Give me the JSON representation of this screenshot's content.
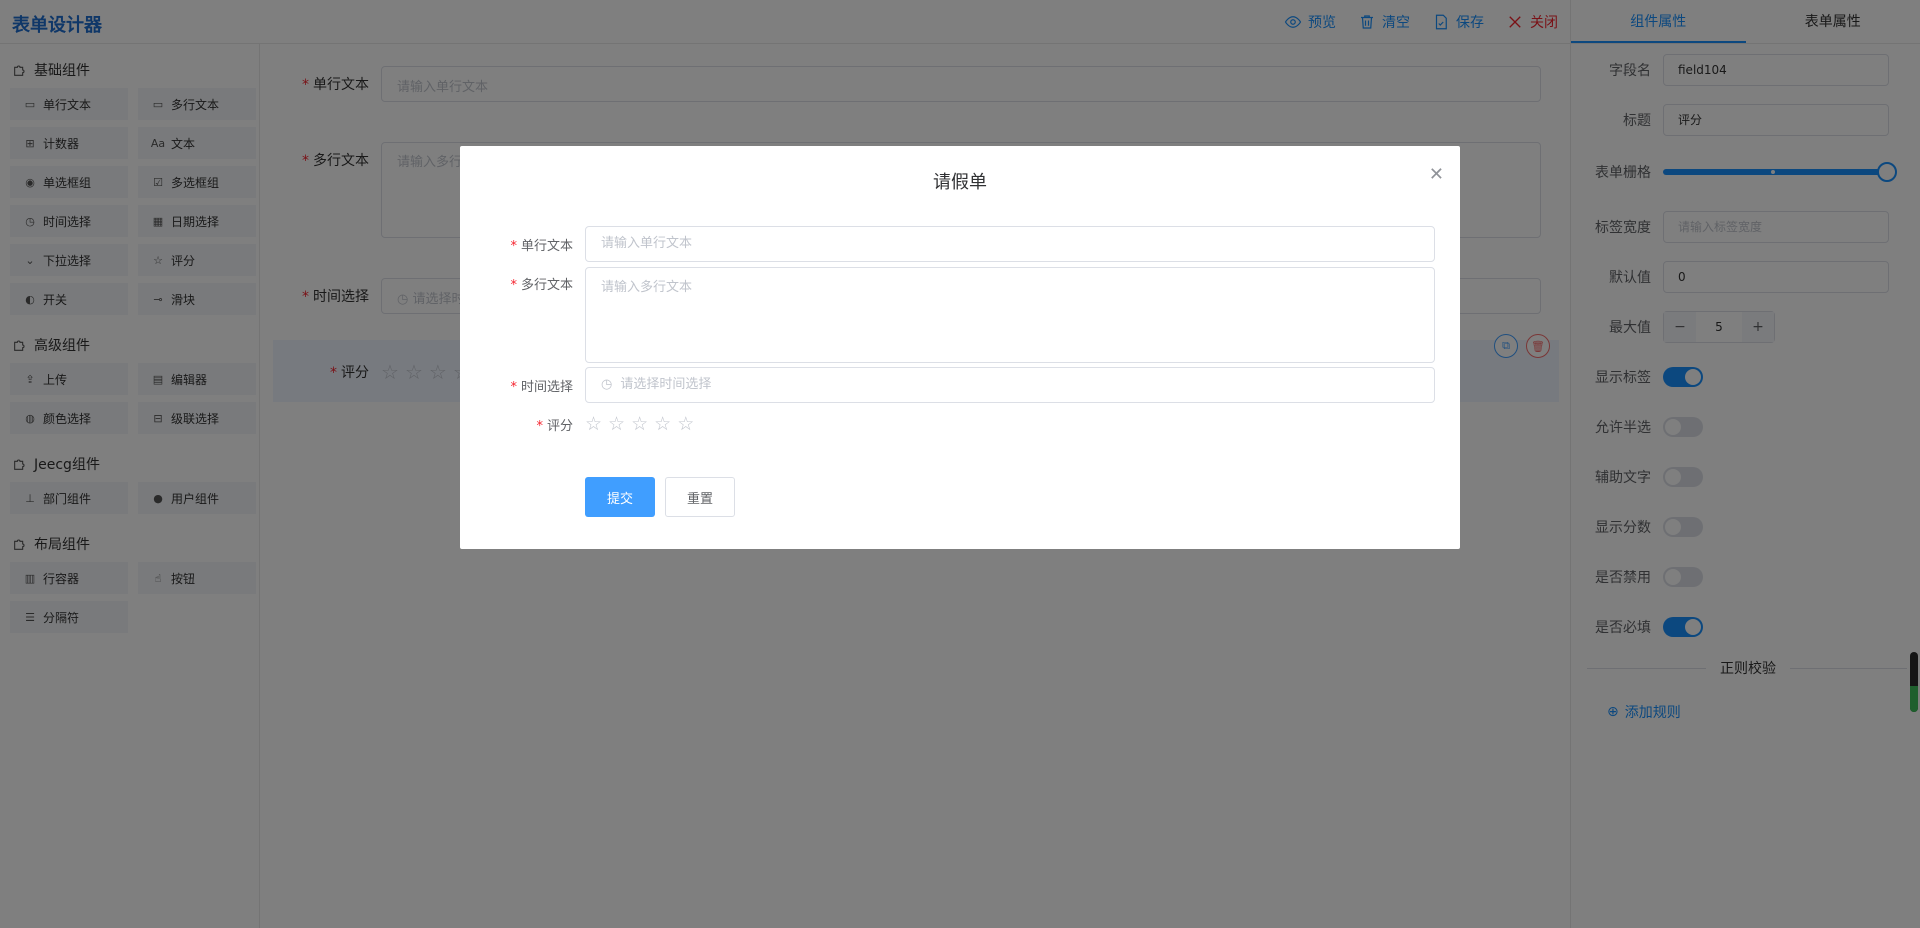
{
  "header": {
    "logo": "表单设计器",
    "toolbar": {
      "preview": "预览",
      "clear": "清空",
      "save": "保存",
      "close": "关闭"
    }
  },
  "left": {
    "groups": [
      {
        "title": "基础组件",
        "items": [
          {
            "label": "单行文本",
            "icon": "input-icon",
            "glyph": "▭"
          },
          {
            "label": "多行文本",
            "icon": "textarea-icon",
            "glyph": "▭"
          },
          {
            "label": "计数器",
            "icon": "counter-icon",
            "glyph": "⊞"
          },
          {
            "label": "文本",
            "icon": "text-icon",
            "glyph": "Aa"
          },
          {
            "label": "单选框组",
            "icon": "radio-icon",
            "glyph": "◉"
          },
          {
            "label": "多选框组",
            "icon": "checkbox-icon",
            "glyph": "☑"
          },
          {
            "label": "时间选择",
            "icon": "clock-icon",
            "glyph": "◷"
          },
          {
            "label": "日期选择",
            "icon": "calendar-icon",
            "glyph": "▦"
          },
          {
            "label": "下拉选择",
            "icon": "select-icon",
            "glyph": "⌄"
          },
          {
            "label": "评分",
            "icon": "star-icon",
            "glyph": "☆"
          },
          {
            "label": "开关",
            "icon": "switch-icon",
            "glyph": "◐"
          },
          {
            "label": "滑块",
            "icon": "slider-icon",
            "glyph": "⊸"
          }
        ]
      },
      {
        "title": "高级组件",
        "items": [
          {
            "label": "上传",
            "icon": "upload-icon",
            "glyph": "⇪"
          },
          {
            "label": "编辑器",
            "icon": "editor-icon",
            "glyph": "▤"
          },
          {
            "label": "颜色选择",
            "icon": "palette-icon",
            "glyph": "◍"
          },
          {
            "label": "级联选择",
            "icon": "cascader-icon",
            "glyph": "⊟"
          }
        ]
      },
      {
        "title": "Jeecg组件",
        "items": [
          {
            "label": "部门组件",
            "icon": "org-icon",
            "glyph": "⊥"
          },
          {
            "label": "用户组件",
            "icon": "user-icon",
            "glyph": "●"
          }
        ]
      },
      {
        "title": "布局组件",
        "items": [
          {
            "label": "行容器",
            "icon": "row-icon",
            "glyph": "▥"
          },
          {
            "label": "按钮",
            "icon": "button-icon",
            "glyph": "☝"
          },
          {
            "label": "分隔符",
            "icon": "divider-icon",
            "glyph": "☰"
          }
        ]
      }
    ]
  },
  "canvas": {
    "field1": {
      "label": "单行文本",
      "placeholder": "请输入单行文本"
    },
    "field2": {
      "label": "多行文本",
      "placeholder": "请输入多行文本"
    },
    "field3": {
      "label": "时间选择",
      "placeholder": "请选择时间选择"
    },
    "field4": {
      "label": "评分"
    }
  },
  "props": {
    "tabs": {
      "component": "组件属性",
      "form": "表单属性"
    },
    "field_name": {
      "label": "字段名",
      "value": "field104"
    },
    "title": {
      "label": "标题",
      "value": "评分"
    },
    "grid": {
      "label": "表单栅格",
      "value": 24
    },
    "label_width": {
      "label": "标签宽度",
      "placeholder": "请输入标签宽度"
    },
    "default": {
      "label": "默认值",
      "value": "0"
    },
    "max": {
      "label": "最大值",
      "value": "5"
    },
    "switches": [
      {
        "label": "显示标签",
        "on": true
      },
      {
        "label": "允许半选",
        "on": false
      },
      {
        "label": "辅助文字",
        "on": false
      },
      {
        "label": "显示分数",
        "on": false
      },
      {
        "label": "是否禁用",
        "on": false
      },
      {
        "label": "是否必填",
        "on": true
      }
    ],
    "regex_title": "正则校验",
    "add_rule": "添加规则"
  },
  "dialog": {
    "title": "请假单",
    "field1": {
      "label": "单行文本",
      "placeholder": "请输入单行文本"
    },
    "field2": {
      "label": "多行文本",
      "placeholder": "请输入多行文本"
    },
    "field3": {
      "label": "时间选择",
      "placeholder": "请选择时间选择"
    },
    "field4": {
      "label": "评分",
      "rating": 0,
      "max": 5
    },
    "submit": "提交",
    "reset": "重置"
  },
  "colors": {
    "primary": "#409eff",
    "brand": "#1890ff",
    "danger": "#f5222d"
  }
}
